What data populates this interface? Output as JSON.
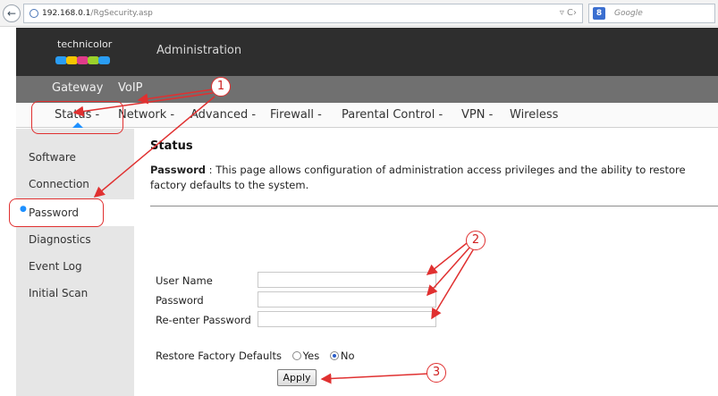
{
  "browser": {
    "url_host": "192.168.0.1",
    "url_path": "/RgSecurity.asp",
    "search_placeholder": "Google",
    "search_engine_badge": "8",
    "back_icon": "arrow-left-icon"
  },
  "header": {
    "brand": "technicolor",
    "brand_colors": [
      "#2a9df4",
      "#f5c400",
      "#e03c8a",
      "#9bd12b",
      "#2a9df4"
    ],
    "title": "Administration"
  },
  "nav_primary": [
    {
      "label": "Gateway"
    },
    {
      "label": "VoIP"
    }
  ],
  "nav_secondary": [
    {
      "label": "Status -"
    },
    {
      "label": "Network -"
    },
    {
      "label": "Advanced -"
    },
    {
      "label": "Firewall -"
    },
    {
      "label": "Parental Control -"
    },
    {
      "label": "VPN -"
    },
    {
      "label": "Wireless"
    }
  ],
  "sidebar": {
    "items": [
      {
        "label": "Software"
      },
      {
        "label": "Connection"
      },
      {
        "label": "Password",
        "selected": true
      },
      {
        "label": "Diagnostics"
      },
      {
        "label": "Event Log"
      },
      {
        "label": "Initial Scan"
      }
    ]
  },
  "main": {
    "title": "Status",
    "desc_label": "Password",
    "desc_sep": " : ",
    "desc_text": "This page allows configuration of administration access privileges and the ability to restore factory defaults to the system.",
    "fields": [
      {
        "label": "User Name",
        "value": ""
      },
      {
        "label": "Password",
        "value": ""
      },
      {
        "label": "Re-enter Password",
        "value": ""
      }
    ],
    "restore_label": "Restore Factory Defaults",
    "restore_options": [
      {
        "label": "Yes",
        "checked": false
      },
      {
        "label": "No",
        "checked": true
      }
    ],
    "apply_label": "Apply"
  },
  "annotations": {
    "color": "#e03030",
    "markers": [
      "1",
      "2",
      "3"
    ]
  }
}
